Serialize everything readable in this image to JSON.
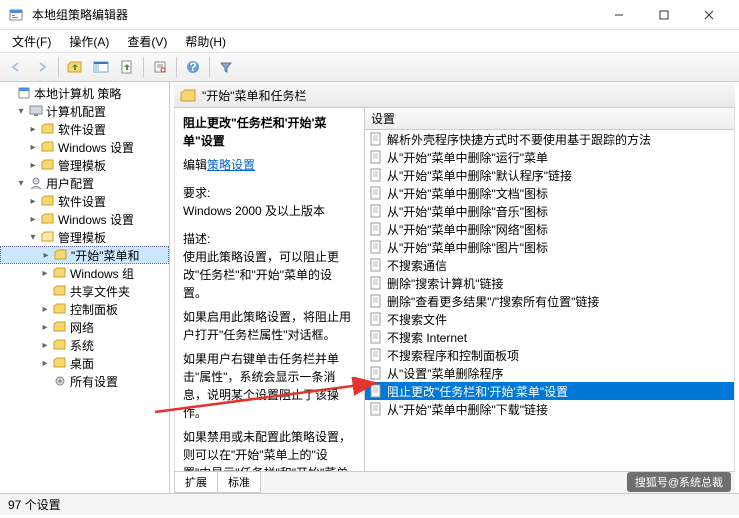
{
  "window": {
    "title": "本地组策略编辑器"
  },
  "menu": {
    "file": "文件(F)",
    "action": "操作(A)",
    "view": "查看(V)",
    "help": "帮助(H)"
  },
  "tree": {
    "root": "本地计算机 策略",
    "computer": "计算机配置",
    "comp_soft": "软件设置",
    "comp_win": "Windows 设置",
    "comp_admin": "管理模板",
    "user": "用户配置",
    "user_soft": "软件设置",
    "user_win": "Windows 设置",
    "user_admin": "管理模板",
    "start_menu": "\"开始\"菜单和",
    "win_comp": "Windows 组",
    "shared": "共享文件夹",
    "ctrl_panel": "控制面板",
    "network": "网络",
    "system": "系统",
    "desktop": "桌面",
    "all": "所有设置"
  },
  "header": {
    "title": "\"开始\"菜单和任务栏"
  },
  "desc": {
    "title": "阻止更改\"任务栏和'开始'菜单\"设置",
    "edit": "编辑",
    "policy_link": "策略设置",
    "req_label": "要求:",
    "req_text": "Windows 2000 及以上版本",
    "desc_label": "描述:",
    "p1": "使用此策略设置，可以阻止更改\"任务栏\"和\"开始\"菜单的设置。",
    "p2": "如果启用此策略设置，将阻止用户打开\"任务栏属性\"对话框。",
    "p3": "如果用户右键单击任务栏并单击\"属性\"，系统会显示一条消息，说明某个设置阻止了该操作。",
    "p4": "如果禁用或未配置此策略设置，则可以在\"开始\"菜单上的\"设置\"中显示\"任务栏\"和\"开始\"菜单项。"
  },
  "list": {
    "col": "设置",
    "items": [
      "解析外壳程序快捷方式时不要使用基于跟踪的方法",
      "从\"开始\"菜单中删除\"运行\"菜单",
      "从\"开始\"菜单中删除\"默认程序\"链接",
      "从\"开始\"菜单中删除\"文档\"图标",
      "从\"开始\"菜单中删除\"音乐\"图标",
      "从\"开始\"菜单中删除\"网络\"图标",
      "从\"开始\"菜单中删除\"图片\"图标",
      "不搜索通信",
      "删除\"搜索计算机\"链接",
      "删除\"查看更多结果\"/\"搜索所有位置\"链接",
      "不搜索文件",
      "不搜索 Internet",
      "不搜索程序和控制面板项",
      "从\"设置\"菜单删除程序",
      "阻止更改\"任务栏和'开始'菜单\"设置",
      "从\"开始\"菜单中删除\"下载\"链接"
    ],
    "selected_index": 14
  },
  "tabs": {
    "extended": "扩展",
    "standard": "标准"
  },
  "status": {
    "count": "97 个设置"
  },
  "watermark": "搜狐号@系统总裁"
}
